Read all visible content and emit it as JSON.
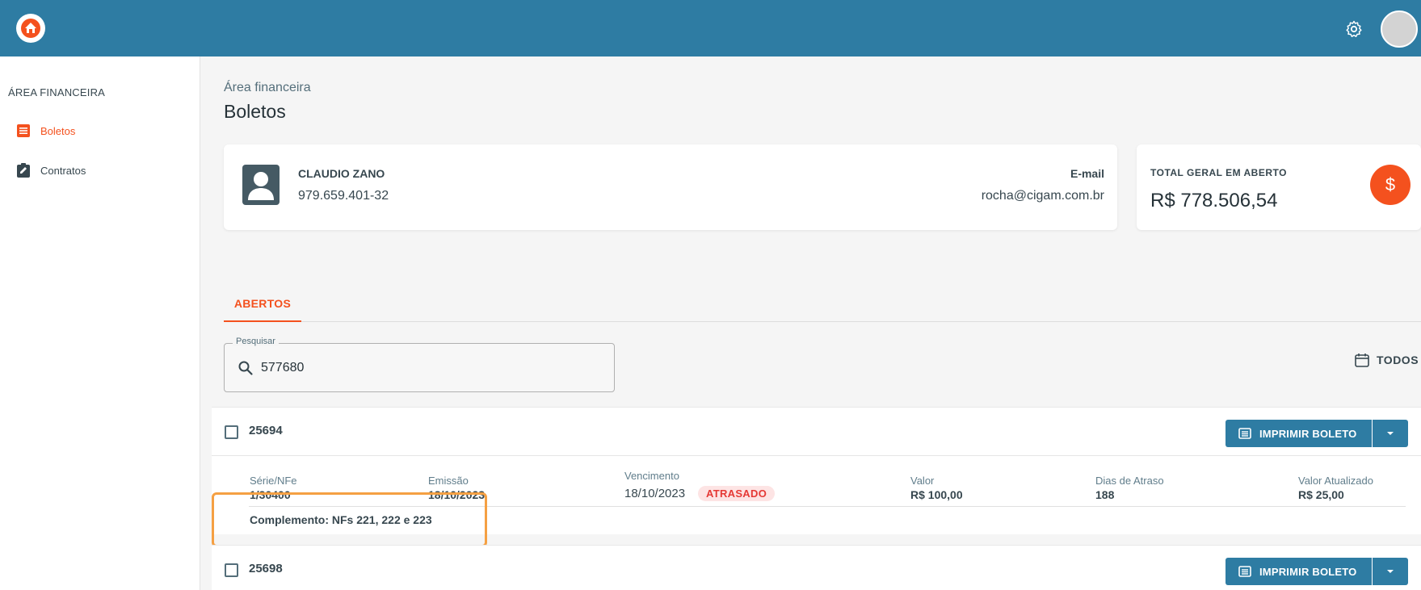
{
  "sidebar": {
    "section_title": "ÁREA FINANCEIRA",
    "items": [
      {
        "label": "Boletos",
        "icon": "list-icon",
        "active": true
      },
      {
        "label": "Contratos",
        "icon": "clipboard-edit-icon",
        "active": false
      }
    ]
  },
  "header": {
    "breadcrumb": "Área financeira",
    "title": "Boletos"
  },
  "customer": {
    "name": "CLAUDIO ZANO",
    "document": "979.659.401-32",
    "email_label": "E-mail",
    "email": "rocha@cigam.com.br"
  },
  "total": {
    "label": "TOTAL GERAL EM ABERTO",
    "value": "R$ 778.506,54",
    "icon_glyph": "$"
  },
  "tabs": [
    {
      "label": "ABERTOS",
      "active": true
    }
  ],
  "search": {
    "label": "Pesquisar",
    "value": "577680"
  },
  "filter": {
    "label": "TODOS"
  },
  "boletos": [
    {
      "number": "25694",
      "print_label": "IMPRIMIR BOLETO",
      "fields": {
        "serie_label": "Série/NFe",
        "serie_value": "1/30400",
        "emissao_label": "Emissão",
        "emissao_value": "18/10/2023",
        "vencimento_label": "Vencimento",
        "vencimento_value": "18/10/2023",
        "status": "ATRASADO",
        "valor_label": "Valor",
        "valor_value": "R$ 100,00",
        "dias_label": "Dias de Atraso",
        "dias_value": "188",
        "atualizado_label": "Valor Atualizado",
        "atualizado_value": "R$ 25,00"
      },
      "complement": "Complemento: NFs 221, 222 e 223"
    },
    {
      "number": "25698",
      "print_label": "IMPRIMIR BOLETO"
    }
  ],
  "colors": {
    "topbar": "#2e7ca3",
    "accent": "#f4511e",
    "button": "#2e7ca3",
    "danger": "#e53935",
    "highlight": "#f5a043"
  }
}
